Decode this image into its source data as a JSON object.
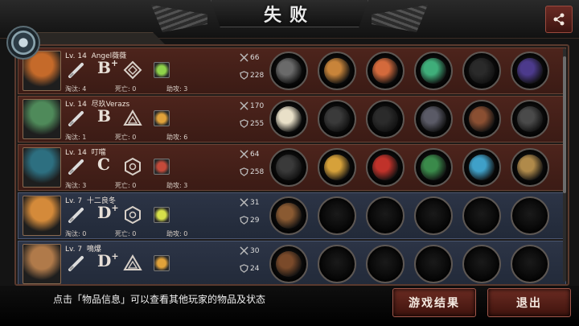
{
  "header": {
    "title": "失败",
    "tab_text": "*"
  },
  "players": [
    {
      "level_label": "Lv. 14",
      "name": "Angel薇薇",
      "grade": "B",
      "grade_plus": "+",
      "eliminated": "淘汰: 4",
      "deaths": "死亡: 0",
      "assists": "助攻: 3",
      "kills": "66",
      "score": "228",
      "row_style": "red",
      "portrait_color": "#c56a2a",
      "rank_icon": "diamond-rank-icon",
      "mini_icon_color": "#8fd24a",
      "items": [
        "#6a6a6a",
        "#c8843a",
        "#d46a3c",
        "#3fae7a",
        "#2a2a2a",
        "#4c3a8c"
      ]
    },
    {
      "level_label": "Lv. 14",
      "name": "尽玖Verazs",
      "grade": "B",
      "grade_plus": "",
      "eliminated": "淘汰: 1",
      "deaths": "死亡: 0",
      "assists": "助攻: 6",
      "kills": "170",
      "score": "255",
      "row_style": "red",
      "portrait_color": "#4f8a5a",
      "rank_icon": "triangle-rank-icon",
      "mini_icon_color": "#e0a23a",
      "items": [
        "#e9e0c8",
        "#3a3a3a",
        "#2b2b2b",
        "#5a5a66",
        "#8a4f32",
        "#4a4a4a"
      ]
    },
    {
      "level_label": "Lv. 14",
      "name": "叮噹",
      "grade": "C",
      "grade_plus": "",
      "eliminated": "淘汰: 3",
      "deaths": "死亡: 0",
      "assists": "助攻: 3",
      "kills": "64",
      "score": "258",
      "row_style": "red",
      "portrait_color": "#2d6f80",
      "rank_icon": "hexagon-rank-icon",
      "mini_icon_color": "#c44a3a",
      "items": [
        "#3a3a3a",
        "#d6a13a",
        "#c0322a",
        "#3a8a4a",
        "#3fa0c8",
        "#b08a4a"
      ]
    },
    {
      "level_label": "Lv. 7",
      "name": "十二良冬",
      "grade": "D",
      "grade_plus": "+",
      "eliminated": "淘汰: 0",
      "deaths": "死亡: 0",
      "assists": "助攻: 0",
      "kills": "31",
      "score": "29",
      "row_style": "blue",
      "portrait_color": "#d48a3a",
      "rank_icon": "hexagon-rank-icon",
      "mini_icon_color": "#d6e04a",
      "items": [
        "#8a5a32",
        "",
        "",
        "",
        "",
        ""
      ]
    },
    {
      "level_label": "Lv. 7",
      "name": "鳴爆",
      "grade": "D",
      "grade_plus": "+",
      "eliminated": "",
      "deaths": "",
      "assists": "",
      "kills": "30",
      "score": "24",
      "row_style": "blue",
      "portrait_color": "#b07a4a",
      "rank_icon": "triangle-rank-icon",
      "mini_icon_color": "#e0a23a",
      "items": [
        "#7a4a2a",
        "",
        "",
        "",
        "",
        ""
      ]
    }
  ],
  "footer": {
    "hint": "点击「物品信息」可以查看其他玩家的物品及状态",
    "result_button": "游戏结果",
    "exit_button": "退出"
  }
}
